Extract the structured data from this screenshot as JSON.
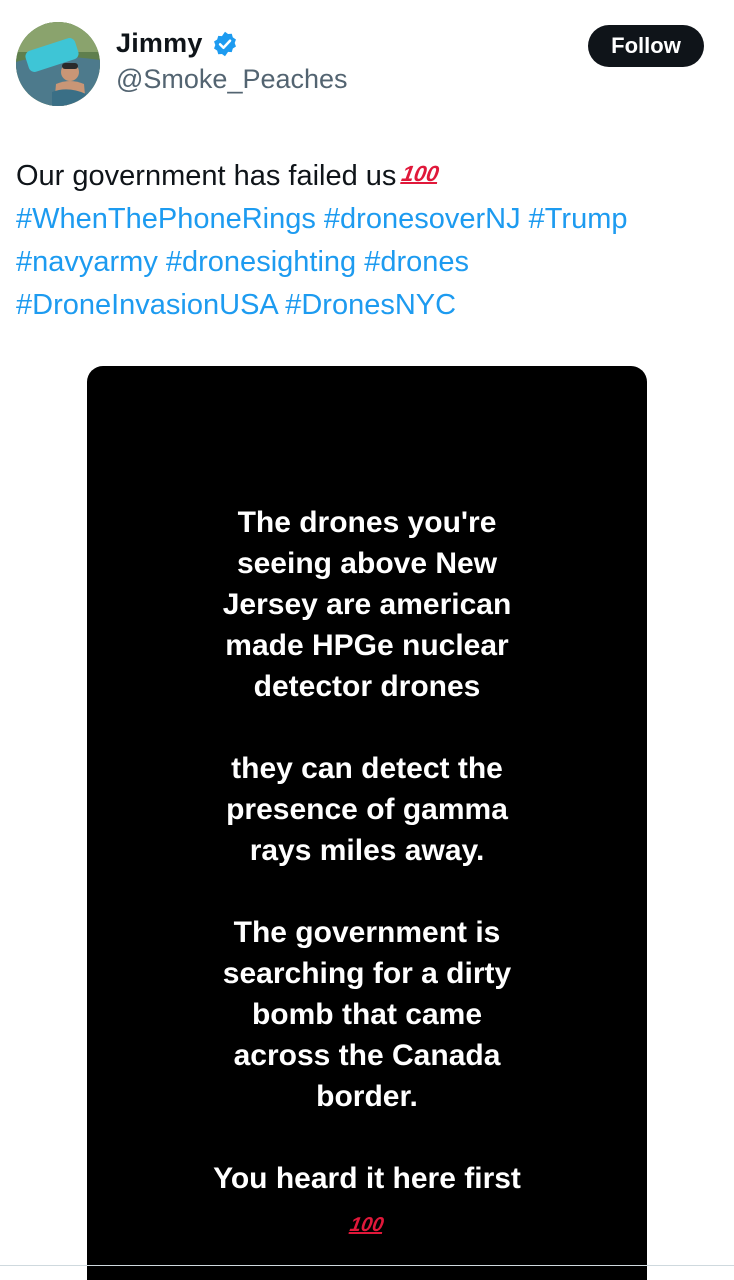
{
  "header": {
    "display_name": "Jimmy",
    "handle": "@Smoke_Peaches",
    "follow_label": "Follow"
  },
  "tweet": {
    "text": "Our government has failed us",
    "emoji": "💯",
    "hashtags_line1": [
      "#WhenThePhoneRings",
      "#dronesoverNJ",
      "#Trump"
    ],
    "hashtags_line2": [
      "#navyarmy",
      "#dronesighting",
      "#drones"
    ],
    "hashtags_line3": [
      "#DroneInvasionUSA",
      "#DronesNYC"
    ]
  },
  "media": {
    "paragraphs": [
      [
        "The drones you're",
        "seeing above New",
        "Jersey are american",
        "made HPGe nuclear",
        "detector drones"
      ],
      [
        "they can detect the",
        "presence of gamma",
        "rays miles away."
      ],
      [
        "The government is",
        "searching for a dirty",
        "bomb that came",
        "across the Canada",
        "border."
      ],
      [
        "You heard it here first"
      ]
    ],
    "closing_emoji": "💯"
  },
  "colors": {
    "link": "#1d9bf0",
    "text": "#0f1419",
    "secondary": "#536471",
    "verified": "#1d9bf0"
  }
}
